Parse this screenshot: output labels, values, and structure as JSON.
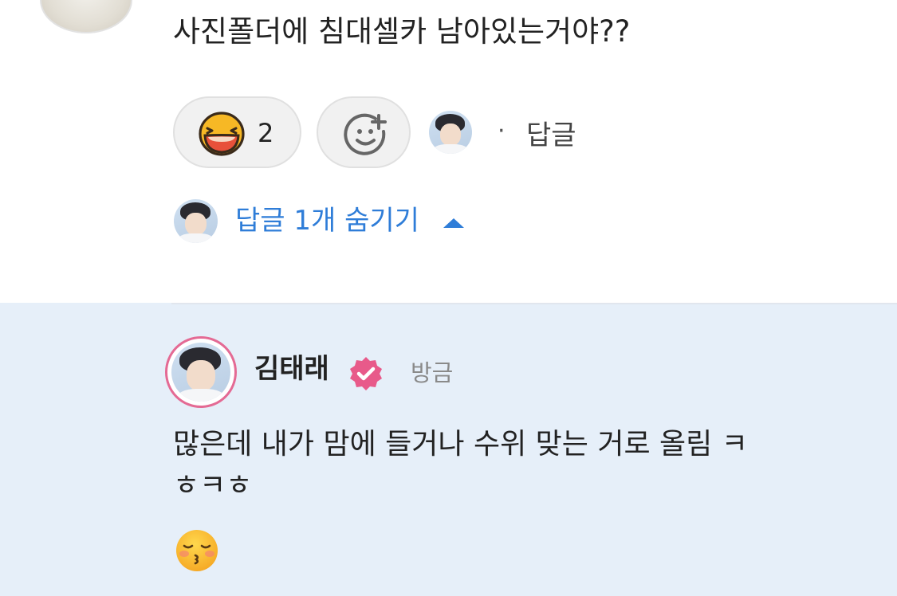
{
  "comment": {
    "text": "사진폴더에 침대셀카 남아있는거야??",
    "reactions": [
      {
        "icon": "laughing-emoji-icon",
        "count": "2"
      }
    ],
    "add_reaction_icon": "add-reaction-icon",
    "separator": "·",
    "reply_label": "답글"
  },
  "replies_toggle": {
    "label": "답글 1개 숨기기",
    "icon": "caret-up-icon",
    "color": "#2f7dd8"
  },
  "reply": {
    "author": "김태래",
    "verified_icon": "verified-badge-icon",
    "verified_color": "#e85a8a",
    "timestamp": "방금",
    "text_line1": "많은데 내가 맘에 들거나 수위 맞는 거로 올림 ㅋ",
    "text_line2": "ㅎㅋㅎ",
    "emoji": "kissing-face-icon",
    "background": "#e6eff9"
  }
}
